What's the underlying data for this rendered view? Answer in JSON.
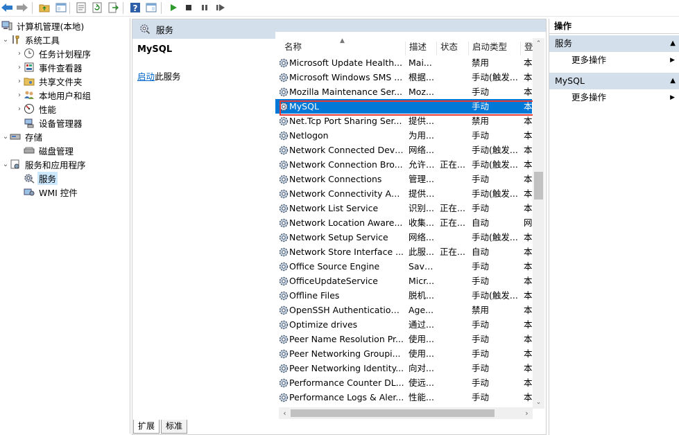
{
  "toolbar": {
    "buttons": [
      "back-icon",
      "forward-icon",
      "up-folder-icon",
      "show-hide-tree-icon",
      "properties-icon",
      "refresh-icon",
      "export-list-icon",
      "help-icon",
      "show-action-pane-icon",
      "start-service-icon",
      "stop-service-icon",
      "pause-service-icon",
      "resume-service-icon"
    ]
  },
  "tree": {
    "root": "计算机管理(本地)",
    "system_tools": "系统工具",
    "task_scheduler": "任务计划程序",
    "event_viewer": "事件查看器",
    "shared_folders": "共享文件夹",
    "local_users": "本地用户和组",
    "performance": "性能",
    "device_manager": "设备管理器",
    "storage": "存储",
    "disk_management": "磁盘管理",
    "services_apps": "服务和应用程序",
    "services": "服务",
    "wmi": "WMI 控件"
  },
  "middle": {
    "header": "服务",
    "detail_title": "MySQL",
    "detail_action_link": "启动",
    "detail_action_rest": "此服务",
    "columns": {
      "name": "名称",
      "desc": "描述",
      "status": "状态",
      "startup": "启动类型",
      "logon": "登"
    },
    "rows": [
      {
        "name": "Microsoft Update Health...",
        "desc": "Mai...",
        "status": "",
        "startup": "禁用",
        "logon": "本"
      },
      {
        "name": "Microsoft Windows SMS ...",
        "desc": "根据...",
        "status": "",
        "startup": "手动(触发...",
        "logon": "本"
      },
      {
        "name": "Mozilla Maintenance Ser...",
        "desc": "Moz...",
        "status": "",
        "startup": "手动",
        "logon": "本"
      },
      {
        "name": "MySQL",
        "desc": "",
        "status": "",
        "startup": "手动",
        "logon": "本"
      },
      {
        "name": "Net.Tcp Port Sharing Ser...",
        "desc": "提供...",
        "status": "",
        "startup": "禁用",
        "logon": "本"
      },
      {
        "name": "Netlogon",
        "desc": "为用...",
        "status": "",
        "startup": "手动",
        "logon": "本"
      },
      {
        "name": "Network Connected Devi...",
        "desc": "网络...",
        "status": "",
        "startup": "手动(触发...",
        "logon": "本"
      },
      {
        "name": "Network Connection Bro...",
        "desc": "允许 ...",
        "status": "正在...",
        "startup": "手动(触发...",
        "logon": "本"
      },
      {
        "name": "Network Connections",
        "desc": "管理...",
        "status": "",
        "startup": "手动",
        "logon": "本"
      },
      {
        "name": "Network Connectivity Ass...",
        "desc": "提供 ...",
        "status": "",
        "startup": "手动(触发...",
        "logon": "本"
      },
      {
        "name": "Network List Service",
        "desc": "识别...",
        "status": "正在...",
        "startup": "手动",
        "logon": "本"
      },
      {
        "name": "Network Location Aware...",
        "desc": "收集...",
        "status": "正在...",
        "startup": "自动",
        "logon": "网"
      },
      {
        "name": "Network Setup Service",
        "desc": "网络...",
        "status": "",
        "startup": "手动(触发...",
        "logon": "本"
      },
      {
        "name": "Network Store Interface ...",
        "desc": "此服...",
        "status": "正在...",
        "startup": "自动",
        "logon": "本"
      },
      {
        "name": "Office  Source Engine",
        "desc": "Save...",
        "status": "",
        "startup": "手动",
        "logon": "本"
      },
      {
        "name": "OfficeUpdateService",
        "desc": "Micr...",
        "status": "",
        "startup": "手动",
        "logon": "本"
      },
      {
        "name": "Offline Files",
        "desc": "脱机...",
        "status": "",
        "startup": "手动(触发...",
        "logon": "本"
      },
      {
        "name": "OpenSSH Authentication ...",
        "desc": "Age...",
        "status": "",
        "startup": "禁用",
        "logon": "本"
      },
      {
        "name": "Optimize drives",
        "desc": "通过...",
        "status": "",
        "startup": "手动",
        "logon": "本"
      },
      {
        "name": "Peer Name Resolution Pr...",
        "desc": "使用...",
        "status": "",
        "startup": "手动",
        "logon": "本"
      },
      {
        "name": "Peer Networking Groupi...",
        "desc": "使用...",
        "status": "",
        "startup": "手动",
        "logon": "本"
      },
      {
        "name": "Peer Networking Identity...",
        "desc": "向对...",
        "status": "",
        "startup": "手动",
        "logon": "本"
      },
      {
        "name": "Performance Counter DL...",
        "desc": "使远...",
        "status": "",
        "startup": "手动",
        "logon": "本"
      },
      {
        "name": "Performance Logs & Aler...",
        "desc": "性能...",
        "status": "",
        "startup": "手动",
        "logon": "本"
      }
    ],
    "selected_index": 3,
    "tabs": {
      "extended": "扩展",
      "standard": "标准"
    }
  },
  "actions": {
    "title": "操作",
    "section1": "服务",
    "section1_more": "更多操作",
    "section2": "MySQL",
    "section2_more": "更多操作"
  },
  "colors": {
    "selection": "#0078d7",
    "highlight_box": "#e53935",
    "header_bg": "#d4dfec"
  }
}
